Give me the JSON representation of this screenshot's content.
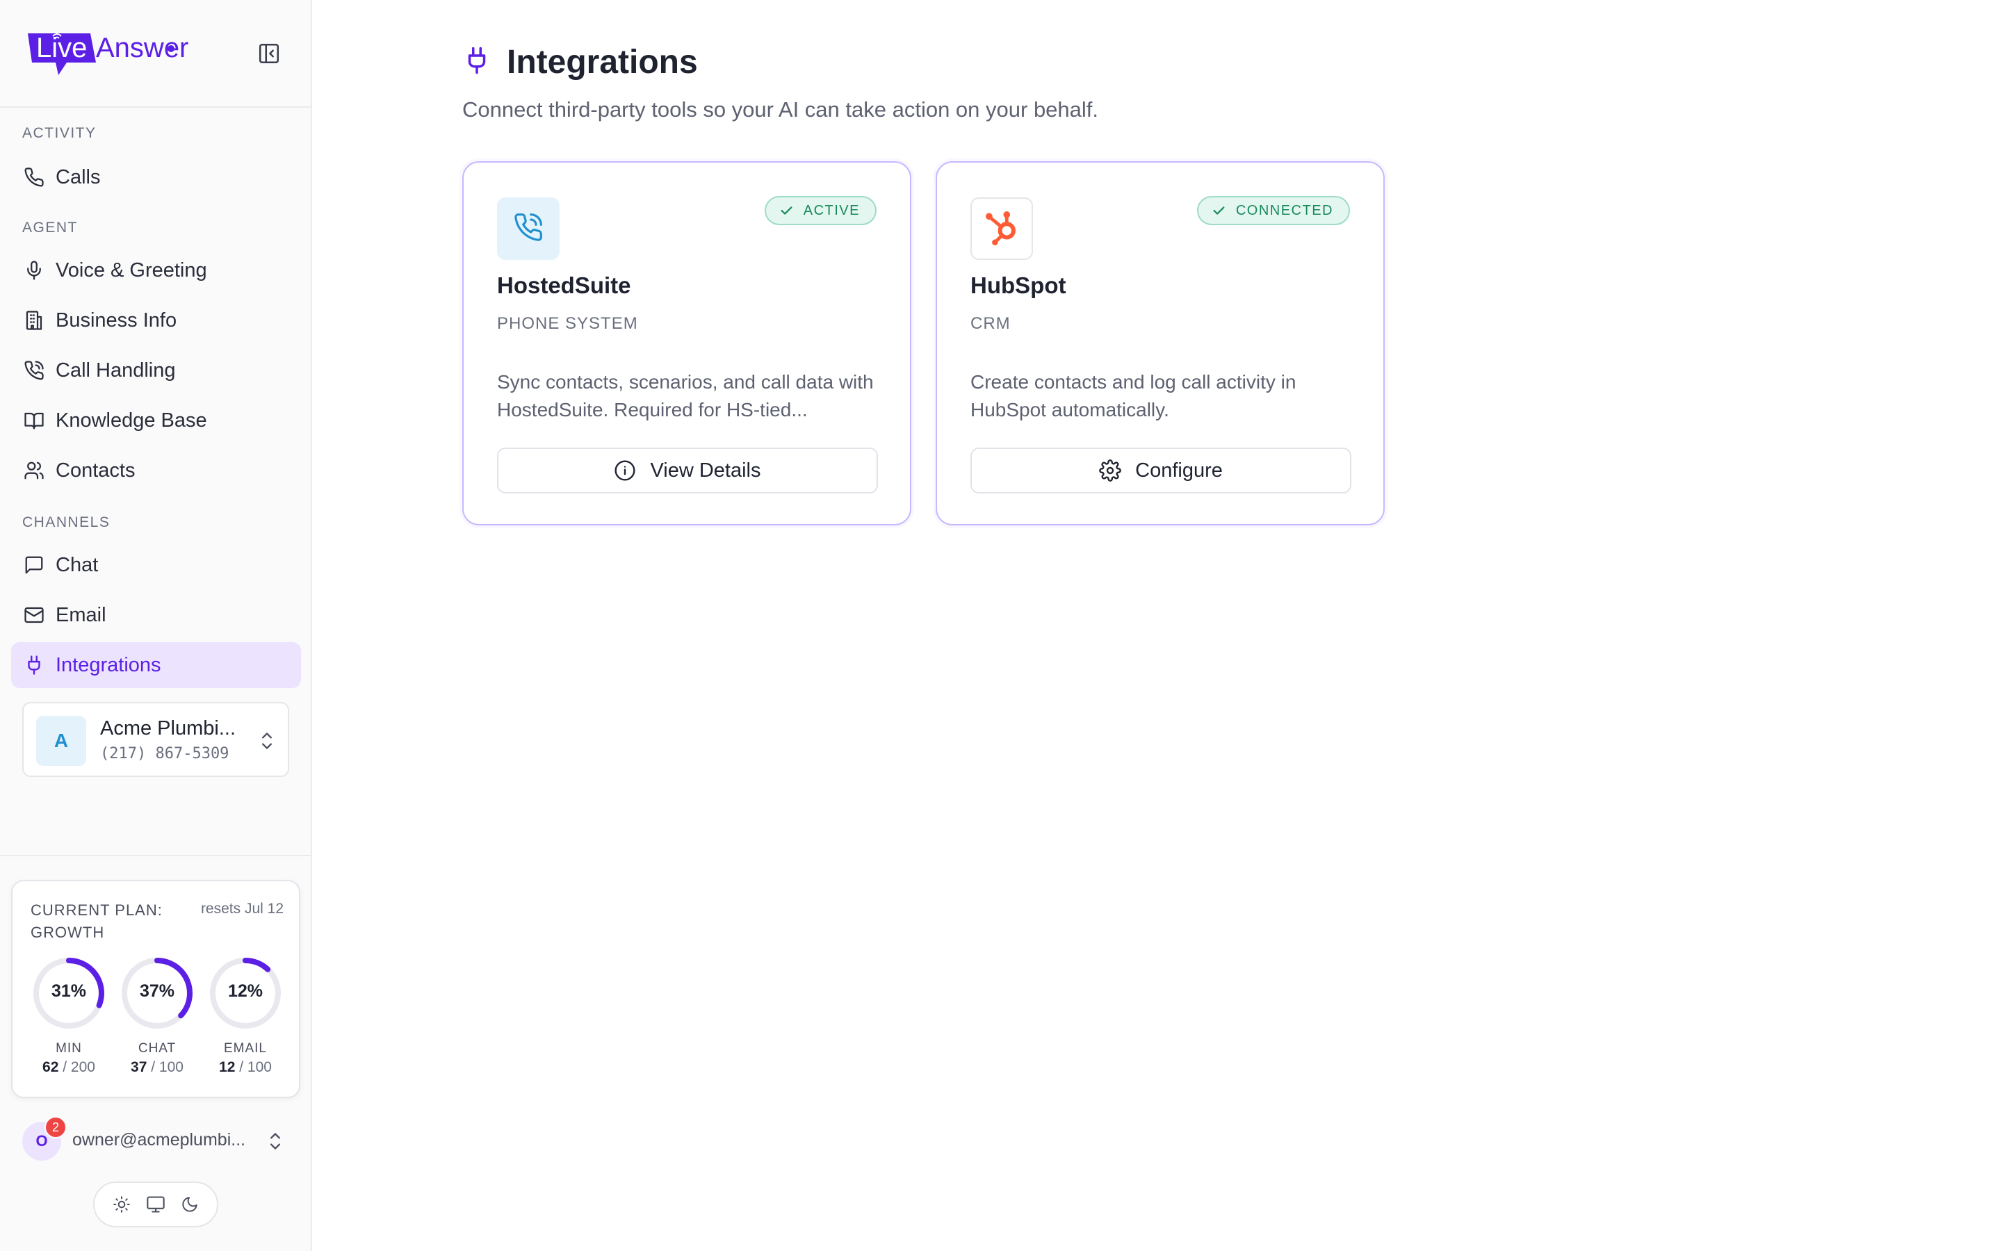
{
  "brand": {
    "name_part1": "Live",
    "name_part2": "Answer",
    "accent": "#5b1fe6"
  },
  "sidebar": {
    "sections": [
      {
        "label": "ACTIVITY"
      },
      {
        "label": "AGENT"
      },
      {
        "label": "CHANNELS"
      }
    ],
    "items": [
      {
        "label": "Calls",
        "icon": "phone-icon"
      },
      {
        "label": "Voice & Greeting",
        "icon": "microphone-icon"
      },
      {
        "label": "Business Info",
        "icon": "building-icon"
      },
      {
        "label": "Call Handling",
        "icon": "phone-call-icon"
      },
      {
        "label": "Knowledge Base",
        "icon": "book-icon"
      },
      {
        "label": "Contacts",
        "icon": "users-icon"
      },
      {
        "label": "Chat",
        "icon": "chat-icon"
      },
      {
        "label": "Email",
        "icon": "mail-icon"
      },
      {
        "label": "Integrations",
        "icon": "plug-icon",
        "active": true
      }
    ],
    "account": {
      "initial": "A",
      "name": "Acme Plumbi...",
      "phone": "(217) 867-5309"
    },
    "plan": {
      "title": "CURRENT PLAN: GROWTH",
      "reset": "resets Jul 12",
      "gauges": [
        {
          "pct_label": "31%",
          "pct": 0.31,
          "label": "MIN",
          "used": "62",
          "limit": "/ 200"
        },
        {
          "pct_label": "37%",
          "pct": 0.37,
          "label": "CHAT",
          "used": "37",
          "limit": "/ 100"
        },
        {
          "pct_label": "12%",
          "pct": 0.12,
          "label": "EMAIL",
          "used": "12",
          "limit": "/ 100"
        }
      ]
    },
    "user": {
      "initial": "O",
      "badge": "2",
      "email": "owner@acmeplumbi..."
    }
  },
  "main": {
    "title": "Integrations",
    "subtitle": "Connect third-party tools so your AI can take action on your behalf.",
    "cards": [
      {
        "name": "HostedSuite",
        "category": "PHONE SYSTEM",
        "status": "ACTIVE",
        "description": "Sync contacts, scenarios, and call data with HostedSuite. Required for HS-tied...",
        "button": "View Details",
        "button_icon": "info-icon",
        "logo_icon": "phone-call-icon",
        "logo_bg": "#e3f2fb"
      },
      {
        "name": "HubSpot",
        "category": "CRM",
        "status": "CONNECTED",
        "description": "Create contacts and log call activity in HubSpot automatically.",
        "button": "Configure",
        "button_icon": "gear-icon",
        "logo_icon": "hubspot-icon",
        "logo_bg": "#ffffff"
      }
    ]
  }
}
